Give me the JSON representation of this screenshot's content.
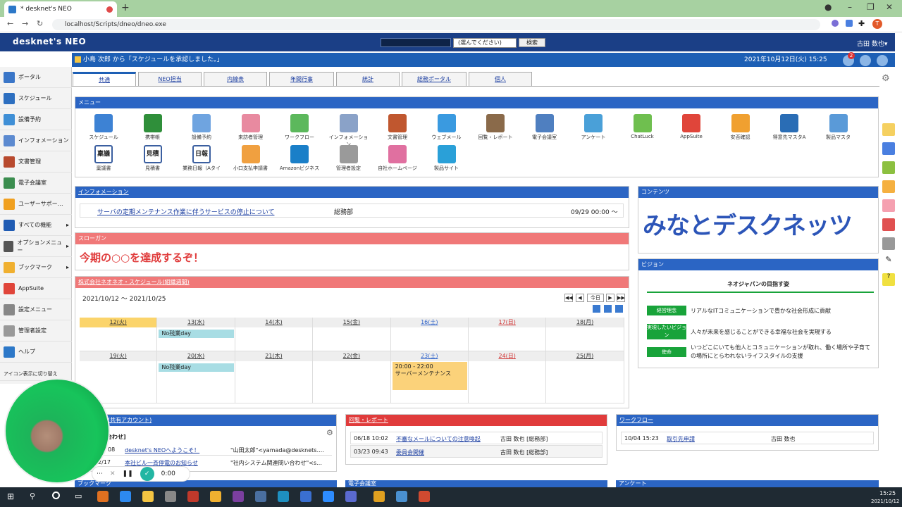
{
  "browser": {
    "tab_title": "* desknet's NEO",
    "url": "localhost/Scripts/dneo/dneo.exe",
    "profile_initial": "T"
  },
  "header": {
    "logo": "desknet's NEO",
    "search_select": "(選んでください)",
    "search_button": "検索",
    "user": "古田 数也▾"
  },
  "notice": {
    "text": "小島 次郎 から「スケジュールを承認しました。」",
    "datetime": "2021年10月12日(火) 15:25",
    "badge": "2"
  },
  "sidebar": {
    "items": [
      {
        "label": "ポータル",
        "color": "#3a76c8"
      },
      {
        "label": "スケジュール",
        "color": "#2d6fc0"
      },
      {
        "label": "設備予約",
        "color": "#3f8fd6"
      },
      {
        "label": "インフォメーション",
        "color": "#5c8ad0"
      },
      {
        "label": "文書管理",
        "color": "#b84a2e"
      },
      {
        "label": "電子会議室",
        "color": "#3b8d4f"
      },
      {
        "label": "ユーザーサポー…",
        "color": "#f0a020"
      },
      {
        "label": "すべての機能",
        "color": "#1f5bb3"
      },
      {
        "label": "オプションメニュー",
        "color": "#555555"
      },
      {
        "label": "ブックマーク",
        "color": "#f0b030"
      },
      {
        "label": "AppSuite",
        "color": "#e0453a"
      },
      {
        "label": "設定メニュー",
        "color": "#888888"
      },
      {
        "label": "管理者設定",
        "color": "#999999"
      },
      {
        "label": "ヘルプ",
        "color": "#2d78c8"
      }
    ],
    "icon_toggle": "アイコン表示に切り替え"
  },
  "tabs": [
    "共通",
    "NEO担当",
    "内線表",
    "年間行事",
    "統計",
    "総務ポータル",
    "個人"
  ],
  "menu": {
    "title": "メニュー",
    "row1": [
      {
        "label": "スケジュール",
        "color": "#3d82d4"
      },
      {
        "label": "携帯帳",
        "color": "#2f8f3a"
      },
      {
        "label": "設備予約",
        "color": "#6fa4e0"
      },
      {
        "label": "来訪者管理",
        "color": "#e88aa0"
      },
      {
        "label": "ワークフロー",
        "color": "#5cb85c"
      },
      {
        "label": "インフォメーション",
        "color": "#8aa2c8"
      },
      {
        "label": "文書管理",
        "color": "#c0572f"
      },
      {
        "label": "ウェブメール",
        "color": "#3a9ae0"
      },
      {
        "label": "回覧・レポート",
        "color": "#8a6a4a"
      },
      {
        "label": "電子会議室",
        "color": "#4f7fc0"
      },
      {
        "label": "アンケート",
        "color": "#4aa0d8"
      },
      {
        "label": "ChatLuck",
        "color": "#6fbf4f"
      },
      {
        "label": "AppSuite",
        "color": "#e0453a"
      },
      {
        "label": "安否確認",
        "color": "#f0a030"
      },
      {
        "label": "得意先マスタA",
        "color": "#2a6db5"
      },
      {
        "label": "製品マスタ",
        "color": "#5a9ad8"
      }
    ],
    "row2": [
      {
        "label": "稟議書",
        "color": "#3b5fa0"
      },
      {
        "label": "見積書",
        "color": "#3b5fa0"
      },
      {
        "label": "業務日報（Aタイ",
        "color": "#3b5fa0"
      },
      {
        "label": "小口支払申請書",
        "color": "#f0a040"
      },
      {
        "label": "Amazonビジネス",
        "color": "#1a7fc8"
      },
      {
        "label": "管理者設定",
        "color": "#9a9a9a"
      },
      {
        "label": "自社ホームページ",
        "color": "#e070a0"
      },
      {
        "label": "製品サイト",
        "color": "#2aa0d8"
      }
    ],
    "row2_text": [
      "稟議",
      "見積",
      "日報"
    ]
  },
  "information": {
    "title": "インフォメーション",
    "item": "サーバの定期メンテナンス作業に伴うサービスの停止について",
    "dept": "総務部",
    "date": "09/29 00:00 ～"
  },
  "slogan": {
    "title": "スローガン",
    "text": "今期の○○を達成するぞ！"
  },
  "schedule": {
    "title": "株式会社ネオネオ・スケジュール(組織週間)",
    "range": "2021/10/12 ～ 2021/10/25",
    "today_btn": "今日",
    "week1": [
      "12(火)",
      "13(水)",
      "14(木)",
      "15(金)",
      "16(土)",
      "17(日)",
      "18(月)"
    ],
    "week2": [
      "19(火)",
      "20(水)",
      "21(木)",
      "22(金)",
      "23(土)",
      "24(日)",
      "25(月)"
    ],
    "events": {
      "e1": "No残業day",
      "e2": "No残業day",
      "e3_time": "20:00 - 22:00",
      "e3_title": "サーバーメンテナンス"
    }
  },
  "contents": {
    "title": "コンテンツ",
    "banner": "みなとデスクネッツ"
  },
  "vision": {
    "title": "ビジョン",
    "heading": "ネオジャパンの目指す姿",
    "rows": [
      {
        "badge": "経営理念",
        "text": "リアルなITコミュニケーションで豊かな社会形成に貢献"
      },
      {
        "badge": "実現したいビジョン",
        "text": "人々が未来を感じることができる幸福な社会を実現する"
      },
      {
        "badge": "使命",
        "text": "いつどこにいても他人とコミュニケーションが取れ、働く場所や子育ての場所にとらわれないライフスタイルの支援"
      }
    ]
  },
  "mail": {
    "title": "ル(共有アカウント)",
    "sub": "合わせ]",
    "rows": [
      {
        "date": "08",
        "subject": "desknet's NEOへようこそ！",
        "from": "\"山田太郎\"<yamada@desknets.…"
      },
      {
        "date": "2/17",
        "subject": "本社ビル一斉停電のお知らせ",
        "from": "\"社内システム関連問い合わせ\"<s…"
      }
    ]
  },
  "circular": {
    "title": "回覧・レポート",
    "rows": [
      {
        "date": "06/18 10:02",
        "subject": "不審なメールについての注意喚起",
        "author": "古田 数也 [総務部]"
      },
      {
        "date": "03/23 09:43",
        "subject": "委員会開催",
        "author": "古田 数也 [総務部]"
      }
    ]
  },
  "workflow": {
    "title": "ワークフロー",
    "row": {
      "date": "10/04 15:23",
      "subject": "取引先申請",
      "author": "古田 数也"
    }
  },
  "bottom": {
    "bookmark": "ブックマーク",
    "meeting": "電子会議室",
    "survey": "アンケート"
  },
  "recorder": {
    "time": "0:00"
  },
  "taskbar": {
    "time": "15:25",
    "date": "2021/10/12"
  }
}
